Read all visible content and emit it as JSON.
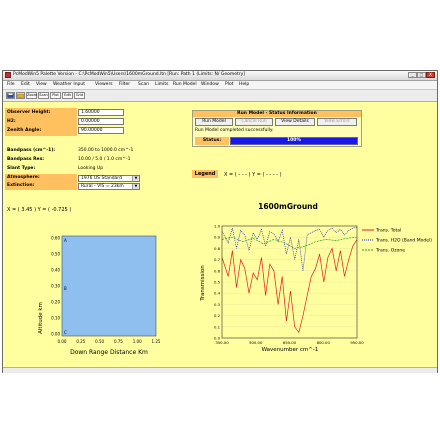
{
  "window": {
    "title": "PcModWin5 Palette Version - C:\\PcModWin5\\Users\\1600mGround.ltn  [Run: Path 1 (Limits: N/ Geometry]",
    "controls": [
      "_",
      "□",
      "X"
    ]
  },
  "menu": [
    "File",
    "Edit",
    "View",
    "Weather Input",
    "Viewers",
    "Filter",
    "Scan",
    "Limits",
    "Run Model",
    "Window",
    "Plot",
    "Help"
  ],
  "toolbar": [
    "Save",
    "Open",
    "Zoom",
    "Scan",
    "Plot",
    "Edit",
    "Grid"
  ],
  "inputs": {
    "observer_height_label": "Observer Height:",
    "observer_height_value": "1.60000",
    "h2_label": "H2:",
    "h2_value": "0.00000",
    "zenith_label": "Zenith Angle:",
    "zenith_value": "90.00000",
    "bandpass_label": "Bandpass (cm^-1):",
    "bandpass_value": "350.00 to 1000.0 cm^-1",
    "bandpass_res_label": "Bandpass Res:",
    "bandpass_res_value": "10.00 / 5.0 / 1.0 cm^-1",
    "slant_label": "Slant Type:",
    "slant_value": "Looking Up",
    "atmosphere_label": "Atmosphere:",
    "atmosphere_value": "1976 US Standard",
    "extinction_label": "Extinction:",
    "extinction_value": "Rural - VIS = 23km"
  },
  "run_panel": {
    "header": "Run Model - Status Information",
    "run_now": "Run Model",
    "cancel_run": "Cancel Run",
    "view_details": "View Details",
    "view_errors": "View Errors",
    "status_text": "Run Model completed successfully.",
    "progress_label": "Status:",
    "progress_value": 1.0,
    "progress_text": "100%"
  },
  "legend_readout": {
    "label": "Legend",
    "x_text": "X = (",
    "x_val": "- - -",
    "y_text": ") Y = (",
    "y_val": "- - - -",
    "close": ")"
  },
  "cursor_readout": {
    "x_text": "X = (",
    "x_val": "3.45",
    "y_text": ") Y = (",
    "y_val": "-0.725",
    "close": ")"
  },
  "geometry_plot": {
    "ylabel": "Altitude km",
    "xlabel": "Down Range Distance Km",
    "yticks": [
      "0.60",
      "0.50",
      "0.40",
      "0.30",
      "0.20",
      "0.10",
      "0.00"
    ],
    "xticks": [
      "0.00",
      "0.25",
      "0.50",
      "0.75",
      "1.00",
      "1.25"
    ],
    "fill_color": "#8fbfef",
    "markers": [
      "A",
      "B",
      "C"
    ]
  },
  "chart_data": {
    "type": "line",
    "title": "1600mGround",
    "xlabel": "Wavenumber cm^-1",
    "ylabel": "Transmission",
    "xlim": [
      350,
      1000
    ],
    "ylim": [
      0,
      1.0
    ],
    "xticks": [
      "350.00",
      "500.00",
      "650.00",
      "800.00",
      "950.00"
    ],
    "yticks": [
      "1.0",
      "0.9",
      "0.8",
      "0.7",
      "0.6",
      "0.5",
      "0.4",
      "0.3",
      "0.2",
      "0.1",
      "0.0"
    ],
    "legend_position": "right",
    "series": [
      {
        "name": "Trans. Total",
        "color": "#e02020",
        "dash": "",
        "x": [
          350,
          380,
          400,
          420,
          440,
          460,
          480,
          500,
          520,
          540,
          560,
          580,
          600,
          620,
          640,
          660,
          680,
          700,
          720,
          740,
          760,
          780,
          800,
          820,
          840,
          860,
          880,
          900,
          920,
          940,
          960,
          980,
          1000
        ],
        "values": [
          0.72,
          0.55,
          0.78,
          0.45,
          0.7,
          0.62,
          0.4,
          0.58,
          0.52,
          0.72,
          0.38,
          0.66,
          0.6,
          0.3,
          0.55,
          0.15,
          0.42,
          0.1,
          0.05,
          0.2,
          0.38,
          0.55,
          0.62,
          0.75,
          0.5,
          0.72,
          0.8,
          0.6,
          0.78,
          0.55,
          0.7,
          0.82,
          0.88
        ]
      },
      {
        "name": "Trans. H2O (Band Model)",
        "color": "#2020c0",
        "dash": "1,1",
        "x": [
          350,
          380,
          400,
          420,
          440,
          460,
          480,
          500,
          520,
          540,
          560,
          580,
          600,
          620,
          640,
          660,
          680,
          700,
          720,
          740,
          760,
          780,
          800,
          820,
          840,
          860,
          880,
          900,
          920,
          940,
          960,
          980,
          1000
        ],
        "values": [
          0.95,
          0.85,
          0.98,
          0.8,
          0.96,
          0.92,
          0.78,
          0.94,
          0.88,
          0.97,
          0.82,
          0.95,
          0.93,
          0.86,
          0.96,
          0.75,
          0.9,
          0.7,
          0.88,
          0.6,
          0.92,
          0.94,
          0.96,
          0.97,
          0.9,
          0.96,
          0.98,
          0.94,
          0.97,
          0.92,
          0.96,
          0.98,
          0.99
        ]
      },
      {
        "name": "Trans. Ozone",
        "color": "#20a020",
        "dash": "2,1",
        "x": [
          350,
          400,
          450,
          500,
          550,
          600,
          650,
          700,
          750,
          800,
          850,
          900,
          950,
          1000
        ],
        "values": [
          0.88,
          0.9,
          0.86,
          0.89,
          0.84,
          0.88,
          0.85,
          0.8,
          0.82,
          0.86,
          0.88,
          0.87,
          0.89,
          0.9
        ]
      }
    ]
  }
}
